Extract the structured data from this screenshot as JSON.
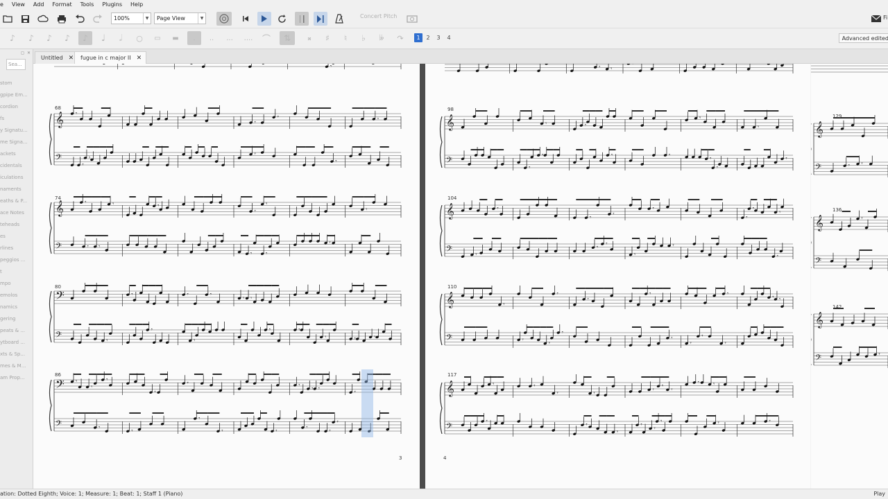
{
  "menubar": {
    "items": [
      "e",
      "View",
      "Add",
      "Format",
      "Tools",
      "Plugins",
      "Help"
    ]
  },
  "toolbar": {
    "zoom_value": "100%",
    "view_mode": "Page View",
    "concert_pitch_label": "Concert Pitch",
    "voices": [
      "1",
      "2",
      "3",
      "4"
    ],
    "advanced_label": "Advanced edited"
  },
  "palette": {
    "search_placeholder": "Sea...",
    "items": [
      "stom",
      "gpipe Em...",
      "cordion",
      "fs",
      "y Signatu...",
      "me Signa...",
      "ackets",
      "cidentals",
      "iculations",
      "naments",
      "eaths & P...",
      "ace Notes",
      "teheads",
      "es",
      "rlines",
      "peggios ...",
      "t",
      "mpo",
      "emolos",
      "namics",
      "gering",
      "peats & ...",
      "ytboard ...",
      "xts & Sp...",
      "mes & M...",
      "am Prop..."
    ]
  },
  "tabs": [
    {
      "label": "Untitled",
      "active": false
    },
    {
      "label": "fugue in c major II",
      "active": true
    }
  ],
  "score": {
    "page3_number": "3",
    "page4_number": "4",
    "measures_p3": [
      "68",
      "74",
      "80",
      "86"
    ],
    "measures_p4": [
      "98",
      "104",
      "110",
      "117"
    ],
    "measures_p5": [
      "129",
      "136",
      "142"
    ]
  },
  "status": {
    "left": "ation: Dotted Eighth; Voice: 1;  Measure: 1; Beat: 1; Staff 1 (Piano)",
    "right": "Play"
  },
  "colors": {
    "selection": "#2f6fd0",
    "gutter": "#4c4c4c"
  }
}
